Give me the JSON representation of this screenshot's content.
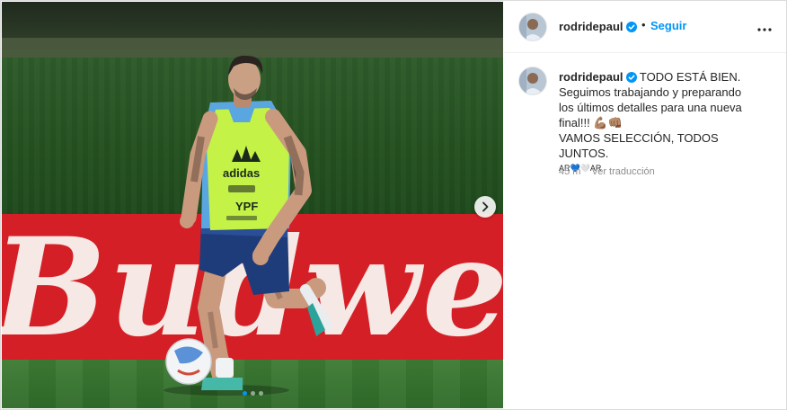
{
  "post": {
    "username": "rodridepaul",
    "follow_label": "Seguir",
    "separator": "•",
    "more_label": "•••",
    "caption": {
      "lead": "TODO ESTÁ BIEN.",
      "lines": [
        "Seguimos trabajando y preparando",
        "los últimos detalles para una nueva",
        "final!!! 💪🏽👊🏽",
        "VAMOS SELECCIÓN, TODOS JUNTOS.",
        "AR💙🤍AR"
      ]
    },
    "timestamp": "45 m",
    "translate_label": "Ver traducción"
  },
  "media": {
    "billboard_text": "Budwei",
    "bib_brand": "adidas",
    "bib_sponsor": "YPF",
    "slide_count": 3,
    "active_slide": 1,
    "next_icon": "chevron-right-icon"
  },
  "colors": {
    "link": "#0095f6",
    "text": "#262626",
    "muted": "#8e8e8e",
    "billboard": "#d51f26"
  }
}
